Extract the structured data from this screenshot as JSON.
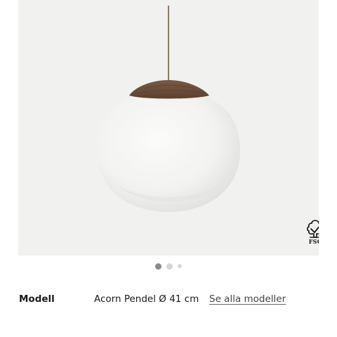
{
  "product": {
    "image_icon": "pendant-lamp-image",
    "certification": {
      "icon": "fsc-tree-icon",
      "label": "FSC"
    }
  },
  "carousel": {
    "dot_count": 3,
    "active_index": 0
  },
  "model": {
    "label": "Modell",
    "value": "Acorn Pendel Ø 41 cm",
    "link_label": "Se alla modeller"
  },
  "colors": {
    "image_background": "#f1f1ef",
    "wood": "#6a4c3a",
    "glass": "#f4f4f2",
    "cord": "#8b7a62",
    "text": "#1a1a1a"
  }
}
